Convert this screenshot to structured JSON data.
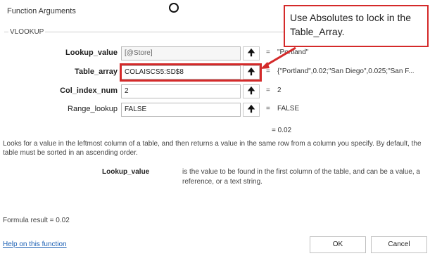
{
  "dialog": {
    "title": "Function Arguments",
    "function_name": "VLOOKUP"
  },
  "args": [
    {
      "label": "Lookup_value",
      "value": "[@Store]",
      "evaluated": "\"Portland\"",
      "bold": true
    },
    {
      "label": "Table_array",
      "value": "COLAISCS5:SD$8",
      "evaluated": "{\"Portland\",0.02;\"San Diego\",0.025;\"San F...",
      "bold": true
    },
    {
      "label": "Col_index_num",
      "value": "2",
      "evaluated": "2",
      "bold": true
    },
    {
      "label": "Range_lookup",
      "value": "FALSE",
      "evaluated": "FALSE",
      "bold": false
    }
  ],
  "equals_sign": "=",
  "ref_button_icon": "up-arrow-icon",
  "result": "= 0.02",
  "description": "Looks for a value in the leftmost column of a table, and then returns a value in the same row from a column you specify. By default, the table must be sorted in an ascending order.",
  "arg_help": {
    "name": "Lookup_value",
    "text": "is the value to be found in the first column of the table, and can be a value, a reference, or a text string."
  },
  "formula_result": "Formula result =   0.02",
  "help_link": "Help on this function",
  "buttons": {
    "ok": "OK",
    "cancel": "Cancel"
  },
  "callout": {
    "text": "Use Absolutes to lock in the Table_Array."
  },
  "colors": {
    "callout_red": "#d42a2a",
    "link_blue": "#1a5fb4"
  }
}
